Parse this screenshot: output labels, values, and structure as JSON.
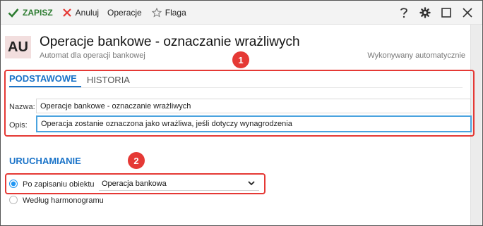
{
  "toolbar": {
    "save_label": "ZAPISZ",
    "cancel_label": "Anuluj",
    "operations_label": "Operacje",
    "flag_label": "Flaga"
  },
  "header": {
    "badge": "AU",
    "title": "Operacje bankowe - oznaczanie wrażliwych",
    "subtitle": "Automat dla operacji bankowej",
    "status": "Wykonywany automatycznie"
  },
  "markers": [
    "1",
    "2"
  ],
  "tabs": [
    {
      "label": "PODSTAWOWE",
      "active": true
    },
    {
      "label": "HISTORIA",
      "active": false
    }
  ],
  "form": {
    "name_label": "Nazwa:",
    "name_value": "Operacje bankowe - oznaczanie wrażliwych",
    "desc_label": "Opis:",
    "desc_value": "Operacja zostanie oznaczona jako wrażliwa, jeśli dotyczy wynagrodzenia"
  },
  "launch": {
    "title": "URUCHAMIANIE",
    "options": [
      {
        "label": "Po zapisaniu obiektu",
        "checked": true
      },
      {
        "label": "Według harmonogramu",
        "checked": false
      }
    ],
    "selected_value": "Operacja bankowa"
  },
  "colors": {
    "accent": "#1a73c8",
    "save_green": "#2e7d32",
    "highlight_red": "#e53935",
    "badge_bg": "#f2dede"
  },
  "icons": {
    "save": "check-icon",
    "cancel": "close-x-icon",
    "flag": "star-outline-icon",
    "help": "question-icon",
    "settings": "gear-icon",
    "maximize": "square-icon",
    "close": "close-icon",
    "dropdown": "chevron-down-icon"
  }
}
